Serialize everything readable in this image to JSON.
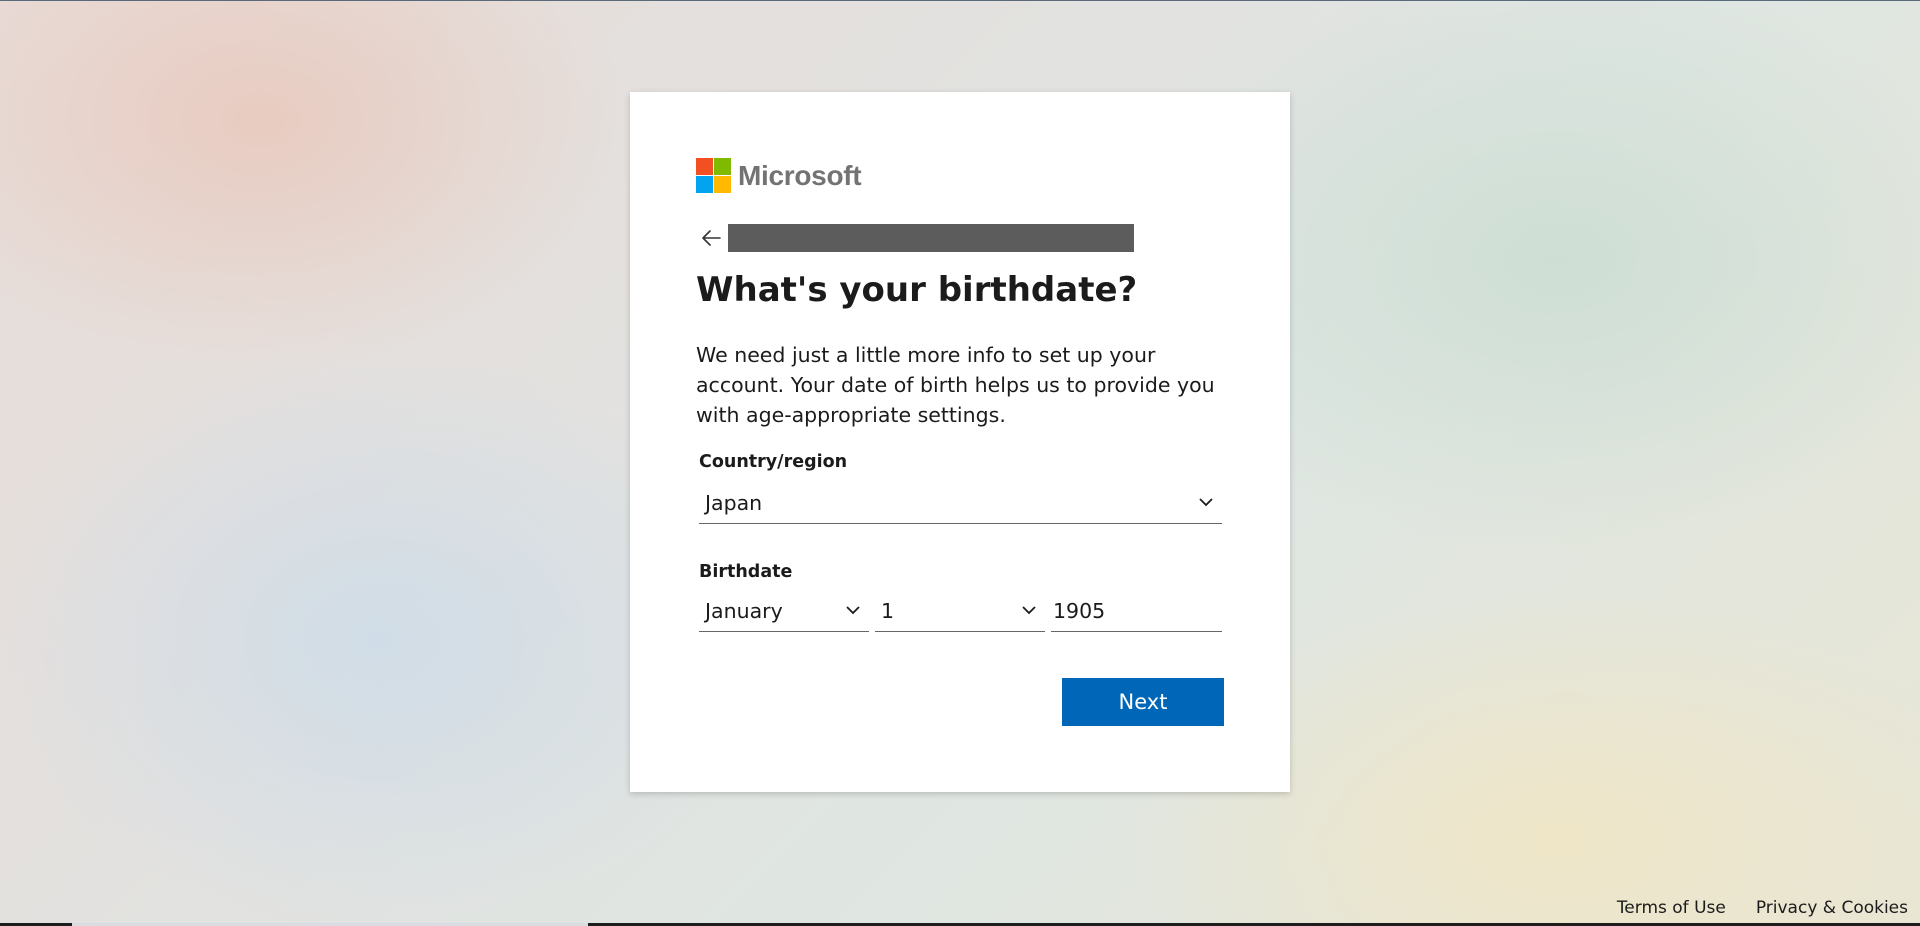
{
  "brand": {
    "name": "Microsoft",
    "colors": [
      "#f25022",
      "#7fba00",
      "#00a4ef",
      "#ffb900"
    ]
  },
  "header": {
    "back_icon": "arrow-left-icon"
  },
  "page": {
    "title": "What's your birthdate?",
    "description": "We need just a little more info to set up your account. Your date of birth helps us to provide you with age-appropriate settings."
  },
  "form": {
    "country_label": "Country/region",
    "country_value": "Japan",
    "birthdate_label": "Birthdate",
    "month_value": "January",
    "day_value": "1",
    "year_value": "1905"
  },
  "actions": {
    "next_label": "Next",
    "accent": "#0067b8"
  },
  "footer": {
    "terms": "Terms of Use",
    "privacy": "Privacy & Cookies"
  }
}
